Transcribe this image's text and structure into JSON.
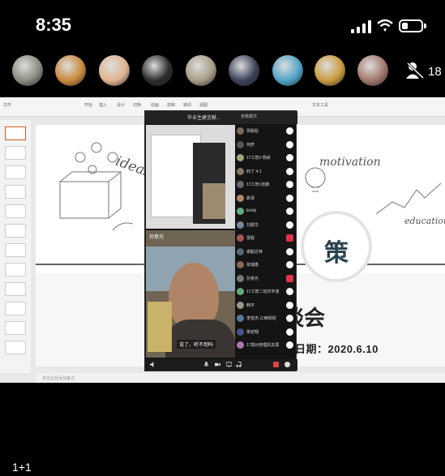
{
  "status": {
    "time": "8:35"
  },
  "avatars": {
    "mute_count": "18",
    "colors": [
      "#8a8a80",
      "#c9893a",
      "#e0b48f",
      "#2b2b2b",
      "#a79b84",
      "#3b4258",
      "#4fa3c7",
      "#c99a3b",
      "#a1766b"
    ]
  },
  "content": {
    "ribbon_tabs": [
      "文件",
      "开始",
      "插入",
      "设计",
      "切换",
      "动画",
      "放映",
      "审阅",
      "视图",
      "文本工具"
    ],
    "slide": {
      "word_ideas": "ideas",
      "word_motivation": "motivation",
      "word_education": "education",
      "center_char": "策",
      "title_fragment": "谈会",
      "date": "日期：2020.6.10"
    },
    "notes_placeholder": "单击此处添加备注"
  },
  "call": {
    "title": "毕业生建言献...",
    "mode": "宫格模式",
    "speaker_name": "孙意光",
    "caption": "说了，听不到吗",
    "participants": [
      {
        "name": "贾毅彪",
        "color": "#7a6a5a",
        "mic": "on"
      },
      {
        "name": "何彦",
        "color": "#555",
        "mic": "on"
      },
      {
        "name": "17工管2 杨启",
        "color": "#9a7",
        "mic": "on"
      },
      {
        "name": "四了 4-1",
        "color": "#876",
        "mic": "on"
      },
      {
        "name": "17工管1张鹏",
        "color": "#667",
        "mic": "on"
      },
      {
        "name": "斯泽",
        "color": "#a86",
        "mic": "on"
      },
      {
        "name": "Emily",
        "color": "#6a8",
        "mic": "on"
      },
      {
        "name": "刘振华",
        "color": "#789",
        "mic": "on"
      },
      {
        "name": "雷毅",
        "color": "#a55",
        "mic": "off"
      },
      {
        "name": "谢毅达林",
        "color": "#567",
        "mic": "on"
      },
      {
        "name": "张瑞勇",
        "color": "#865",
        "mic": "on"
      },
      {
        "name": "孙意光",
        "color": "#777",
        "mic": "off"
      },
      {
        "name": "17工管二班刘宇波",
        "color": "#6a7",
        "mic": "on"
      },
      {
        "name": "韩平",
        "color": "#998",
        "mic": "on"
      },
      {
        "name": "李悦杰-江西财经",
        "color": "#579",
        "mic": "on"
      },
      {
        "name": "吴宏翔",
        "color": "#458",
        "mic": "on"
      },
      {
        "name": "17郑州管理机关局",
        "color": "#a7a",
        "mic": "on"
      }
    ]
  },
  "footer": {
    "page_counter": "1+1"
  }
}
